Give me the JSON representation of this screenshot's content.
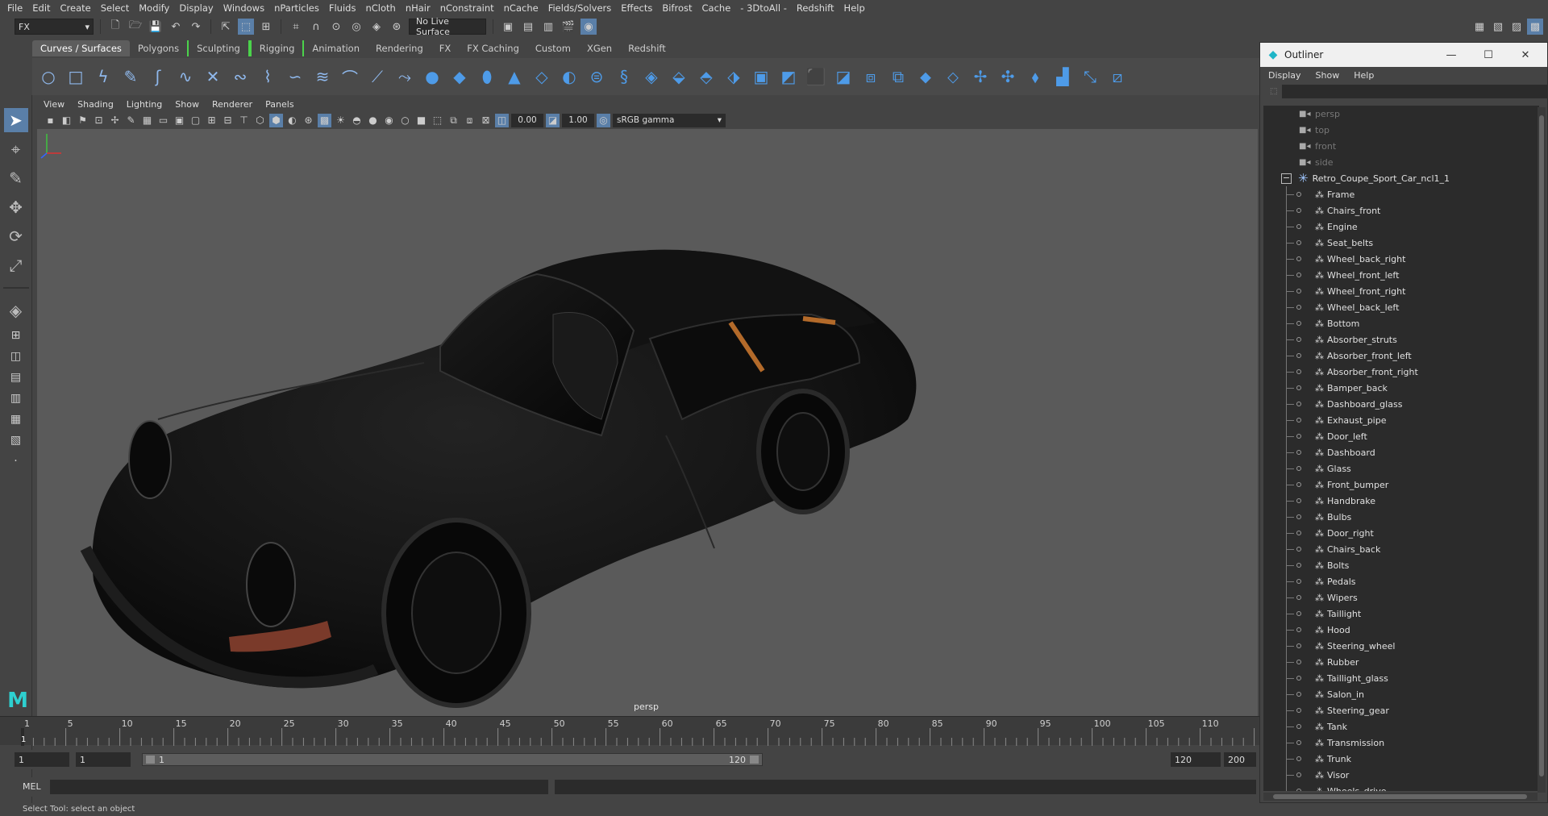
{
  "menubar": [
    "File",
    "Edit",
    "Create",
    "Select",
    "Modify",
    "Display",
    "Windows",
    "nParticles",
    "Fluids",
    "nCloth",
    "nHair",
    "nConstraint",
    "nCache",
    "Fields/Solvers",
    "Effects",
    "Bifrost",
    "Cache",
    "- 3DtoAll -",
    "Redshift",
    "Help"
  ],
  "statusline": {
    "mode": "FX",
    "live_surface": "No Live Surface"
  },
  "shelf_tabs": [
    "Curves / Surfaces",
    "Polygons",
    "Sculpting",
    "Rigging",
    "Animation",
    "Rendering",
    "FX",
    "FX Caching",
    "Custom",
    "XGen",
    "Redshift"
  ],
  "panel_menu": [
    "View",
    "Shading",
    "Lighting",
    "Show",
    "Renderer",
    "Panels"
  ],
  "panel_toolbar": {
    "exposure": "0.00",
    "gamma": "1.00",
    "color_space": "sRGB gamma"
  },
  "viewport": {
    "camera_label": "persp"
  },
  "timeline": {
    "ticks": [
      "1",
      "5",
      "10",
      "15",
      "20",
      "25",
      "30",
      "35",
      "40",
      "45",
      "50",
      "55",
      "60",
      "65",
      "70",
      "75",
      "80",
      "85",
      "90",
      "95",
      "100",
      "105",
      "110"
    ],
    "current": "1"
  },
  "range": {
    "start": "1",
    "anim_start": "1",
    "slider_start": "1",
    "slider_end": "120",
    "playback_end": "120",
    "anim_end": "200"
  },
  "command_line": {
    "label": "MEL"
  },
  "help_line": "Select Tool: select an object",
  "outliner": {
    "title": "Outliner",
    "menu": [
      "Display",
      "Show",
      "Help"
    ],
    "cameras": [
      "persp",
      "top",
      "front",
      "side"
    ],
    "root": "Retro_Coupe_Sport_Car_ncl1_1",
    "children": [
      "Frame",
      "Chairs_front",
      "Engine",
      "Seat_belts",
      "Wheel_back_right",
      "Wheel_front_left",
      "Wheel_front_right",
      "Wheel_back_left",
      "Bottom",
      "Absorber_struts",
      "Absorber_front_left",
      "Absorber_front_right",
      "Bamper_back",
      "Dashboard_glass",
      "Exhaust_pipe",
      "Door_left",
      "Dashboard",
      "Glass",
      "Front_bumper",
      "Handbrake",
      "Bulbs",
      "Door_right",
      "Chairs_back",
      "Bolts",
      "Pedals",
      "Wipers",
      "Taillight",
      "Hood",
      "Steering_wheel",
      "Rubber",
      "Taillight_glass",
      "Salon_in",
      "Steering_gear",
      "Tank",
      "Transmission",
      "Trunk",
      "Visor",
      "Wheels_drive"
    ]
  }
}
